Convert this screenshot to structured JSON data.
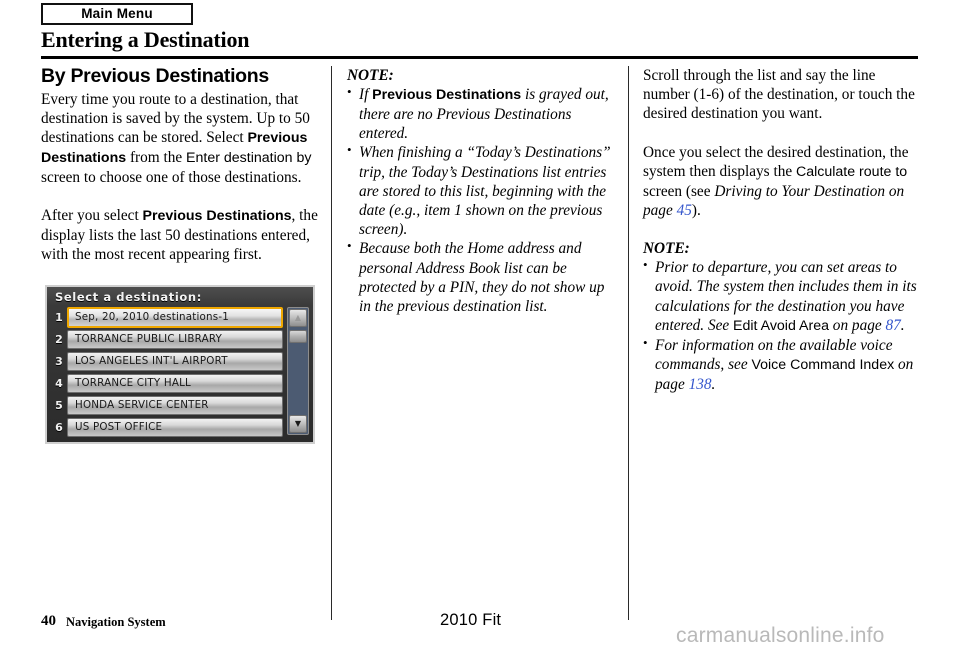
{
  "header": {
    "tab_label": "Main Menu",
    "title": "Entering a Destination"
  },
  "column_left": {
    "section_heading": "By Previous Destinations",
    "para1": {
      "t1": "Every time you route to a destination, that destination is saved by the system. Up to 50 destinations can be stored. Select ",
      "ui_bold1": "Previous Destinations",
      "t2": " from the ",
      "ui1": "Enter destination by",
      "t3": " screen to choose one of those destinations."
    },
    "para2": {
      "t1": "After you select ",
      "ui_bold1": "Previous Destinations",
      "t2": ", the display lists the last 50 destinations entered, with the most recent appearing first."
    }
  },
  "nav_screen": {
    "title": "Select a destination:",
    "rows": [
      {
        "num": "1",
        "label": "Sep, 20, 2010 destinations-1",
        "selected": true
      },
      {
        "num": "2",
        "label": "TORRANCE PUBLIC LIBRARY",
        "selected": false
      },
      {
        "num": "3",
        "label": "LOS ANGELES INT'L AIRPORT",
        "selected": false
      },
      {
        "num": "4",
        "label": "TORRANCE CITY HALL",
        "selected": false
      },
      {
        "num": "5",
        "label": "HONDA SERVICE CENTER",
        "selected": false
      },
      {
        "num": "6",
        "label": "US POST OFFICE",
        "selected": false
      }
    ],
    "scroll_up": "▲",
    "scroll_down": "▼",
    "highlight_color": "#f0a800",
    "track_color": "#4c5b72"
  },
  "column_middle": {
    "note_label": "NOTE:",
    "bullets": [
      {
        "t1": "If ",
        "ui_bold1": "Previous Destinations",
        "t2": " is grayed out, there are no Previous Destinations entered."
      },
      {
        "t1": "When finishing a “Today’s Destinations” trip, the Today’s Destinations list entries are stored to this list, beginning with the date (e.g., item 1 shown on the previous screen)."
      },
      {
        "t1": "Because both the Home address and personal Address Book list can be protected by a PIN, they do not show up in the previous destination list."
      }
    ]
  },
  "column_right": {
    "para1": "Scroll through the list and say the line number (1-6) of the destination, or touch the desired destination you want.",
    "para2": {
      "t1": "Once you select the desired destination, the system then displays the ",
      "ui1": "Calculate route to",
      "t2": " screen (see ",
      "it1": "Driving to Your Destination",
      "t3": " on page ",
      "page1": "45",
      "t4": ")."
    },
    "note_label": "NOTE:",
    "bullets": [
      {
        "t1": "Prior to departure, you can set areas to avoid. The system then includes them in its calculations for the destination you have entered. See ",
        "ui1": "Edit Avoid Area",
        "t2": " on page ",
        "page1": "87",
        "t3": "."
      },
      {
        "t1": "For information on the available voice commands, see ",
        "ui1": "Voice Command Index",
        "t2": " on page ",
        "page1": "138",
        "t3": "."
      }
    ]
  },
  "footer": {
    "page_number": "40",
    "system_name": "Navigation System",
    "model_year": "2010 Fit",
    "watermark": "carmanualsonline.info"
  }
}
